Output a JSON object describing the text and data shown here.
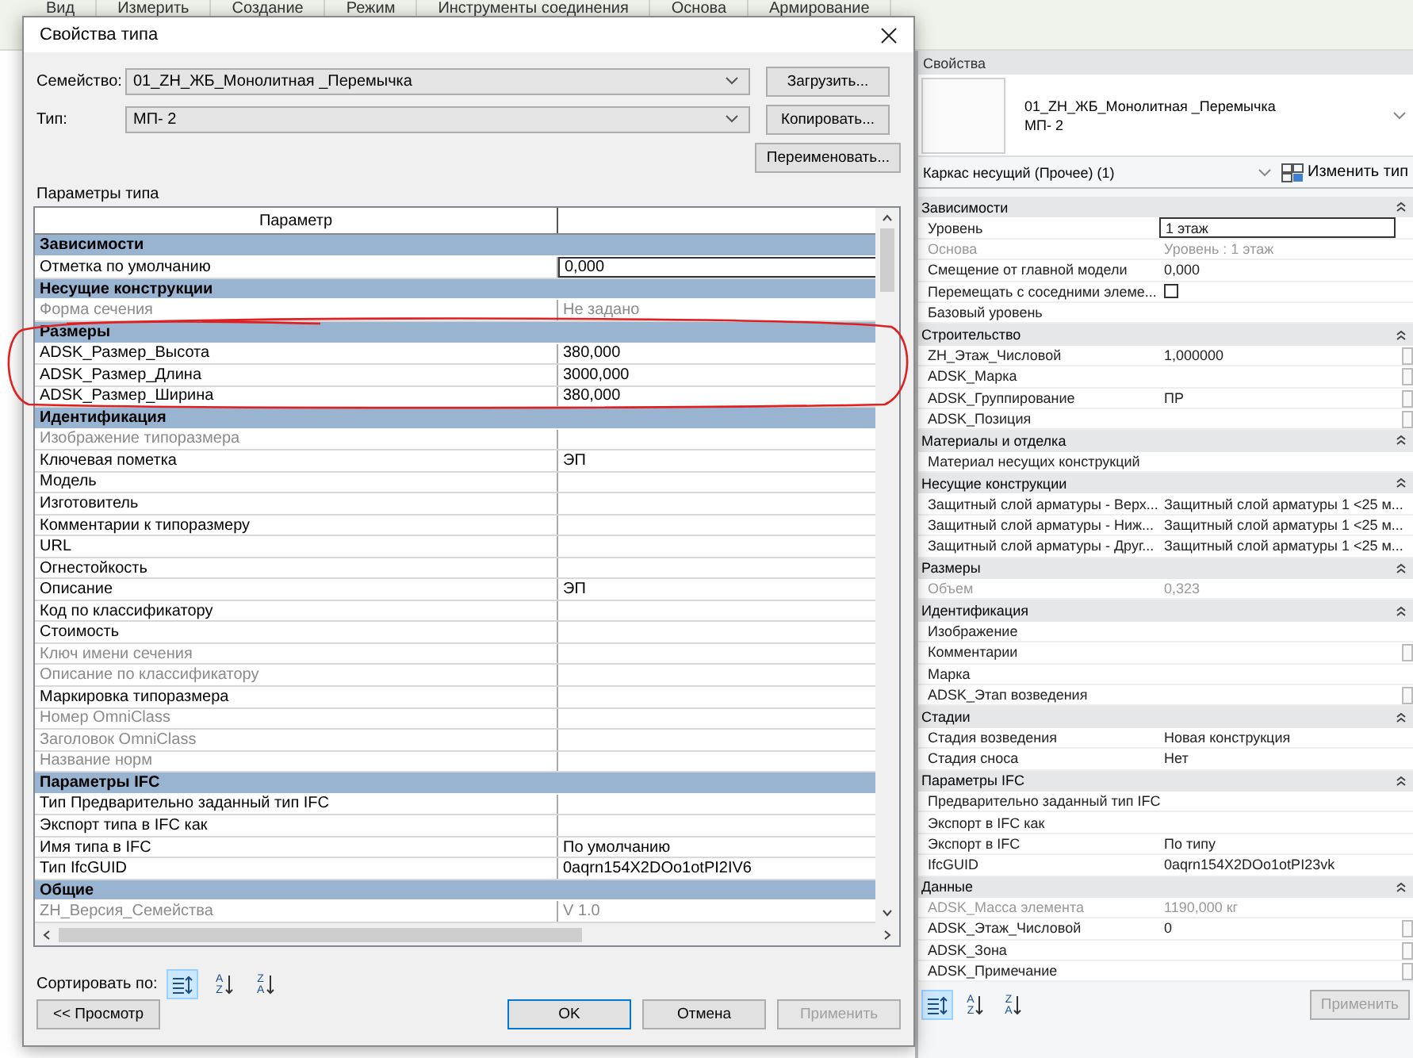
{
  "ribbon_tabs": [
    "Вид",
    "Измерить",
    "Создание",
    "Режим",
    "Инструменты соединения",
    "Основа",
    "Армирование"
  ],
  "dialog": {
    "title": "Свойства типа",
    "family": {
      "label": "Семейство:",
      "value": "01_ZH_ЖБ_Монолитная _Перемычка"
    },
    "type": {
      "label": "Тип:",
      "value": "МП- 2"
    },
    "buttons": [
      "Загрузить...",
      "Копировать...",
      "Переименовать..."
    ],
    "section_label": "Параметры типа",
    "columns": [
      "Параметр"
    ],
    "groups": [
      {
        "name": "Зависимости",
        "rows": [
          {
            "param": "Отметка по умолчанию",
            "value": "0,000",
            "disabled": false,
            "editing": true
          }
        ]
      },
      {
        "name": "Несущие конструкции",
        "rows": [
          {
            "param": "Форма сечения",
            "value": "Не задано",
            "disabled": true,
            "editing": false
          }
        ]
      },
      {
        "name": "Размеры",
        "rows": [
          {
            "param": "ADSK_Размер_Высота",
            "value": "380,000",
            "disabled": false,
            "editing": false
          },
          {
            "param": "ADSK_Размер_Длина",
            "value": "3000,000",
            "disabled": false,
            "editing": false
          },
          {
            "param": "ADSK_Размер_Ширина",
            "value": "380,000",
            "disabled": false,
            "editing": false
          }
        ]
      },
      {
        "name": "Идентификация",
        "rows": [
          {
            "param": "Изображение типоразмера",
            "disabled": true,
            "editing": false
          },
          {
            "param": "Ключевая пометка",
            "value": "ЭП",
            "disabled": false,
            "editing": false
          },
          {
            "param": "Модель",
            "disabled": false,
            "editing": false
          },
          {
            "param": "Изготовитель",
            "disabled": false,
            "editing": false
          },
          {
            "param": "Комментарии к типоразмеру",
            "disabled": false,
            "editing": false
          },
          {
            "param": "URL",
            "disabled": false,
            "editing": false
          },
          {
            "param": "Огнестойкость",
            "disabled": false,
            "editing": false
          },
          {
            "param": "Описание",
            "value": "ЭП",
            "disabled": false,
            "editing": false
          },
          {
            "param": "Код по классификатору",
            "disabled": false,
            "editing": false
          },
          {
            "param": "Стоимость",
            "disabled": false,
            "editing": false
          },
          {
            "param": "Ключ имени сечения",
            "disabled": true,
            "editing": false
          },
          {
            "param": "Описание по классификатору",
            "disabled": true,
            "editing": false
          },
          {
            "param": "Маркировка типоразмера",
            "disabled": false,
            "editing": false
          },
          {
            "param": "Номер OmniClass",
            "disabled": true,
            "editing": false
          },
          {
            "param": "Заголовок OmniClass",
            "disabled": true,
            "editing": false
          },
          {
            "param": "Название норм",
            "disabled": true,
            "editing": false
          }
        ]
      },
      {
        "name": "Параметры IFC",
        "rows": [
          {
            "param": "Тип Предварительно заданный тип IFC",
            "disabled": false,
            "editing": false
          },
          {
            "param": "Экспорт типа в IFC как",
            "disabled": false,
            "editing": false
          },
          {
            "param": "Имя типа в IFC",
            "value": "По умолчанию",
            "disabled": false,
            "editing": false
          },
          {
            "param": "Тип IfcGUID",
            "value": "0aqrn154X2DOo1otPI2IV6",
            "disabled": false,
            "editing": false
          }
        ]
      },
      {
        "name": "Общие",
        "rows": [
          {
            "param": "ZH_Версия_Семейства",
            "value": "V 1.0",
            "disabled": true,
            "editing": false
          }
        ]
      }
    ],
    "sort_label": "Сортировать по:",
    "sort_options": [
      {
        "kind": "grouped",
        "selected": true
      },
      {
        "kind": "ascending",
        "letters": [
          "A",
          "Z"
        ],
        "selected": false
      },
      {
        "kind": "descending",
        "letters": [
          "Z",
          "A"
        ],
        "selected": false
      }
    ],
    "footer_buttons": [
      {
        "label": "<< Просмотр",
        "default": false,
        "disabled": false
      },
      {
        "label": "OK",
        "default": true,
        "disabled": false
      },
      {
        "label": "Отмена",
        "default": false,
        "disabled": false
      },
      {
        "label": "Применить",
        "default": false,
        "disabled": true
      }
    ]
  },
  "properties": {
    "title": "Свойства",
    "family": "01_ZH_ЖБ_Монолитная _Перемычка",
    "type": "МП- 2",
    "category": "Каркас несущий (Прочее) (1)",
    "edit_type": "Изменить тип",
    "groups": [
      {
        "name": "Зависимости",
        "rows": [
          {
            "kind": "text",
            "param": "Уровень",
            "value": "1 этаж",
            "disabled": false,
            "editing": true,
            "side_button": false
          },
          {
            "kind": "text",
            "param": "Основа",
            "value": "Уровень : 1 этаж",
            "disabled": true,
            "editing": false,
            "side_button": false
          },
          {
            "kind": "text",
            "param": "Смещение от главной модели",
            "value": "0,000",
            "disabled": false,
            "editing": false,
            "side_button": false
          },
          {
            "kind": "checkbox",
            "param": "Перемещать с соседними элеме...",
            "checked": false,
            "disabled": false,
            "editing": false,
            "side_button": false
          },
          {
            "kind": "text",
            "param": "Базовый уровень",
            "disabled": false,
            "editing": false,
            "side_button": false
          }
        ]
      },
      {
        "name": "Строительство",
        "rows": [
          {
            "kind": "text",
            "param": "ZH_Этаж_Числовой",
            "value": "1,000000",
            "disabled": false,
            "editing": false,
            "side_button": true
          },
          {
            "kind": "text",
            "param": "ADSK_Марка",
            "disabled": false,
            "editing": false,
            "side_button": true
          },
          {
            "kind": "text",
            "param": "ADSK_Группирование",
            "value": "ПР",
            "disabled": false,
            "editing": false,
            "side_button": true
          },
          {
            "kind": "text",
            "param": "ADSK_Позиция",
            "disabled": false,
            "editing": false,
            "side_button": true
          }
        ]
      },
      {
        "name": "Материалы и отделка",
        "rows": [
          {
            "kind": "text",
            "param": "Материал несущих конструкций",
            "disabled": false,
            "editing": false,
            "side_button": false
          }
        ]
      },
      {
        "name": "Несущие конструкции",
        "rows": [
          {
            "kind": "text",
            "param": "Защитный слой арматуры - Верх...",
            "value": "Защитный слой арматуры 1 <25 м...",
            "disabled": false,
            "editing": false,
            "side_button": false
          },
          {
            "kind": "text",
            "param": "Защитный слой арматуры - Ниж...",
            "value": "Защитный слой арматуры 1 <25 м...",
            "disabled": false,
            "editing": false,
            "side_button": false
          },
          {
            "kind": "text",
            "param": "Защитный слой арматуры - Друг...",
            "value": "Защитный слой арматуры 1 <25 м...",
            "disabled": false,
            "editing": false,
            "side_button": false
          }
        ]
      },
      {
        "name": "Размеры",
        "rows": [
          {
            "kind": "text",
            "param": "Объем",
            "value": "0,323",
            "disabled": true,
            "editing": false,
            "side_button": false
          }
        ]
      },
      {
        "name": "Идентификация",
        "rows": [
          {
            "kind": "text",
            "param": "Изображение",
            "disabled": false,
            "editing": false,
            "side_button": false
          },
          {
            "kind": "text",
            "param": "Комментарии",
            "disabled": false,
            "editing": false,
            "side_button": true
          },
          {
            "kind": "text",
            "param": "Марка",
            "disabled": false,
            "editing": false,
            "side_button": false
          },
          {
            "kind": "text",
            "param": "ADSK_Этап возведения",
            "disabled": false,
            "editing": false,
            "side_button": true
          }
        ]
      },
      {
        "name": "Стадии",
        "rows": [
          {
            "kind": "text",
            "param": "Стадия возведения",
            "value": "Новая конструкция",
            "disabled": false,
            "editing": false,
            "side_button": false
          },
          {
            "kind": "text",
            "param": "Стадия сноса",
            "value": "Нет",
            "disabled": false,
            "editing": false,
            "side_button": false
          }
        ]
      },
      {
        "name": "Параметры IFC",
        "rows": [
          {
            "kind": "text",
            "param": "Предварительно заданный тип IFC",
            "disabled": false,
            "editing": false,
            "side_button": false
          },
          {
            "kind": "text",
            "param": "Экспорт в IFC как",
            "disabled": false,
            "editing": false,
            "side_button": false
          },
          {
            "kind": "text",
            "param": "Экспорт в IFC",
            "value": "По типу",
            "disabled": false,
            "editing": false,
            "side_button": false
          },
          {
            "kind": "text",
            "param": "IfcGUID",
            "value": "0aqrn154X2DOo1otPI23vk",
            "disabled": false,
            "editing": false,
            "side_button": false
          }
        ]
      },
      {
        "name": "Данные",
        "rows": [
          {
            "kind": "text",
            "param": "ADSK_Масса элемента",
            "value": "1190,000 кг",
            "disabled": true,
            "editing": false,
            "side_button": false
          },
          {
            "kind": "text",
            "param": "ADSK_Этаж_Числовой",
            "value": "0",
            "disabled": false,
            "editing": false,
            "side_button": true
          },
          {
            "kind": "text",
            "param": "ADSK_Зона",
            "disabled": false,
            "editing": false,
            "side_button": true
          },
          {
            "kind": "text",
            "param": "ADSK_Примечание",
            "disabled": false,
            "editing": false,
            "side_button": true
          }
        ]
      }
    ],
    "sort_options": [
      {
        "kind": "grouped",
        "selected": true
      },
      {
        "kind": "ascending",
        "letters": [
          "A",
          "Z"
        ],
        "selected": false
      },
      {
        "kind": "descending",
        "letters": [
          "Z",
          "A"
        ],
        "selected": false
      }
    ],
    "apply": {
      "label": "Применить",
      "disabled": true
    }
  }
}
